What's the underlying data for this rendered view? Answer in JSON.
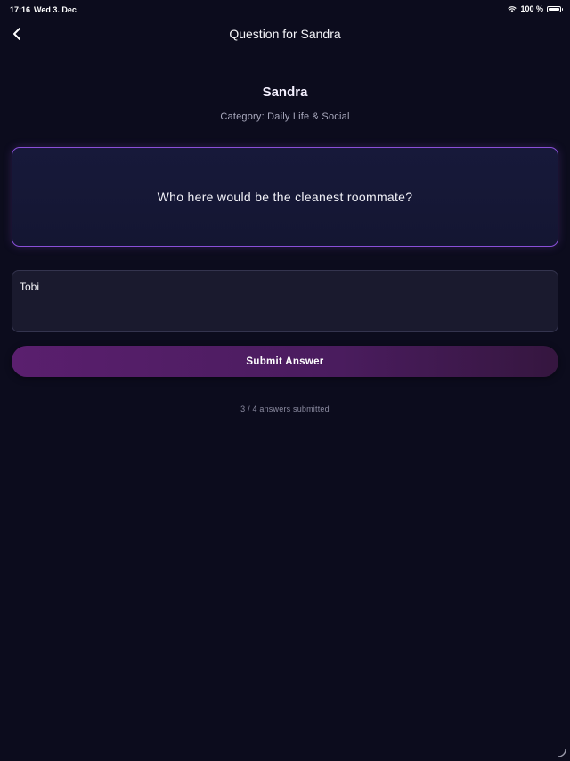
{
  "status_bar": {
    "time": "17:16",
    "date": "Wed 3. Dec",
    "battery": "100 %",
    "wifi_icon": "wifi-icon",
    "battery_icon": "battery-icon"
  },
  "nav": {
    "back_icon": "chevron-left-icon",
    "title": "Question for Sandra"
  },
  "header": {
    "player_name": "Sandra",
    "category": "Category: Daily Life & Social"
  },
  "question": {
    "text": "Who here would be the cleanest roommate?"
  },
  "answer": {
    "value": "Tobi"
  },
  "submit": {
    "label": "Submit Answer"
  },
  "progress": {
    "text": "3 / 4 answers submitted",
    "submitted": 3,
    "total": 4
  },
  "colors": {
    "background": "#0c0c1d",
    "card_border": "#8a4fd8",
    "button_start": "#5a1f6e",
    "button_end": "#35163f"
  }
}
